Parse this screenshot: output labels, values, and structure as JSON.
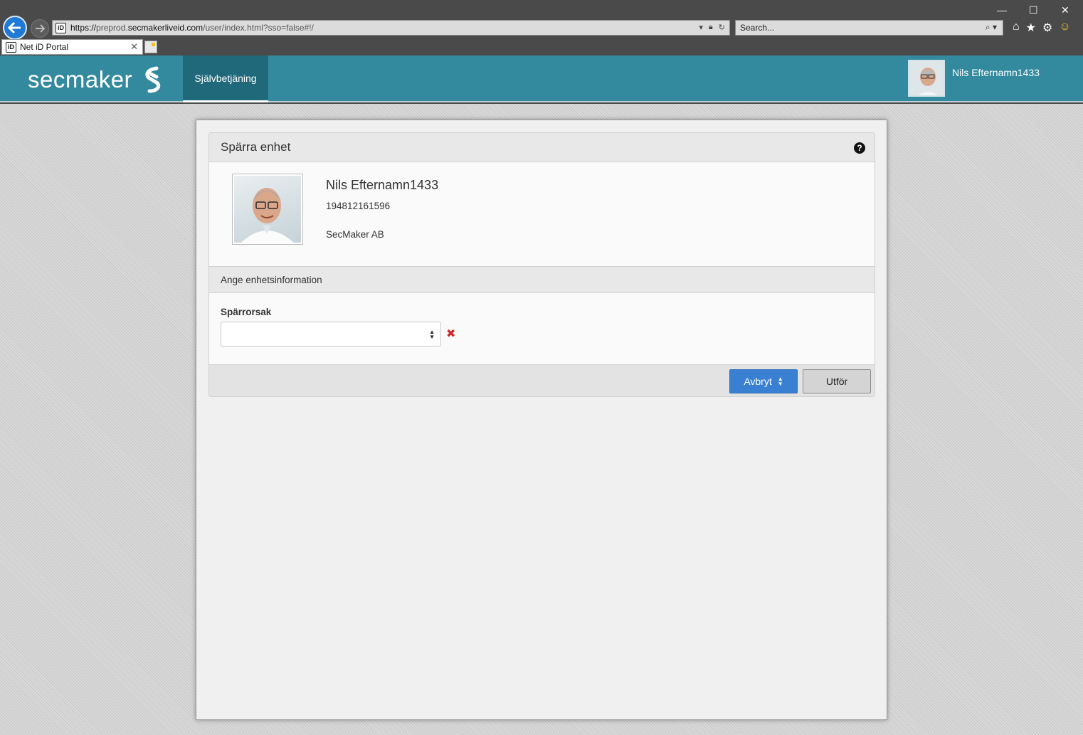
{
  "browser": {
    "url_prefix": "https://",
    "url_subdomain": "preprod.",
    "url_host": "secmakerliveid.com",
    "url_path": "/user/index.html?sso=false#!/",
    "search_placeholder": "Search...",
    "tab_title": "Net iD Portal",
    "site_icon_text": "iD"
  },
  "app": {
    "logo_text": "secmaker",
    "nav_tab": "Självbetjäning",
    "user_name": "Nils Efternamn1433"
  },
  "dialog": {
    "title": "Spärra enhet",
    "help_icon": "?",
    "person": {
      "name": "Nils Efternamn1433",
      "id_number": "194812161596",
      "organization": "SecMaker AB"
    },
    "section_title": "Ange enhetsinformation",
    "field_label": "Spärrorsak",
    "select_value": "",
    "cancel_label": "Avbryt",
    "submit_label": "Utför"
  },
  "colors": {
    "header": "#338a9e",
    "active_tab": "#20697b",
    "primary_button": "#3a80d2",
    "clear_icon": "#d0282b"
  }
}
